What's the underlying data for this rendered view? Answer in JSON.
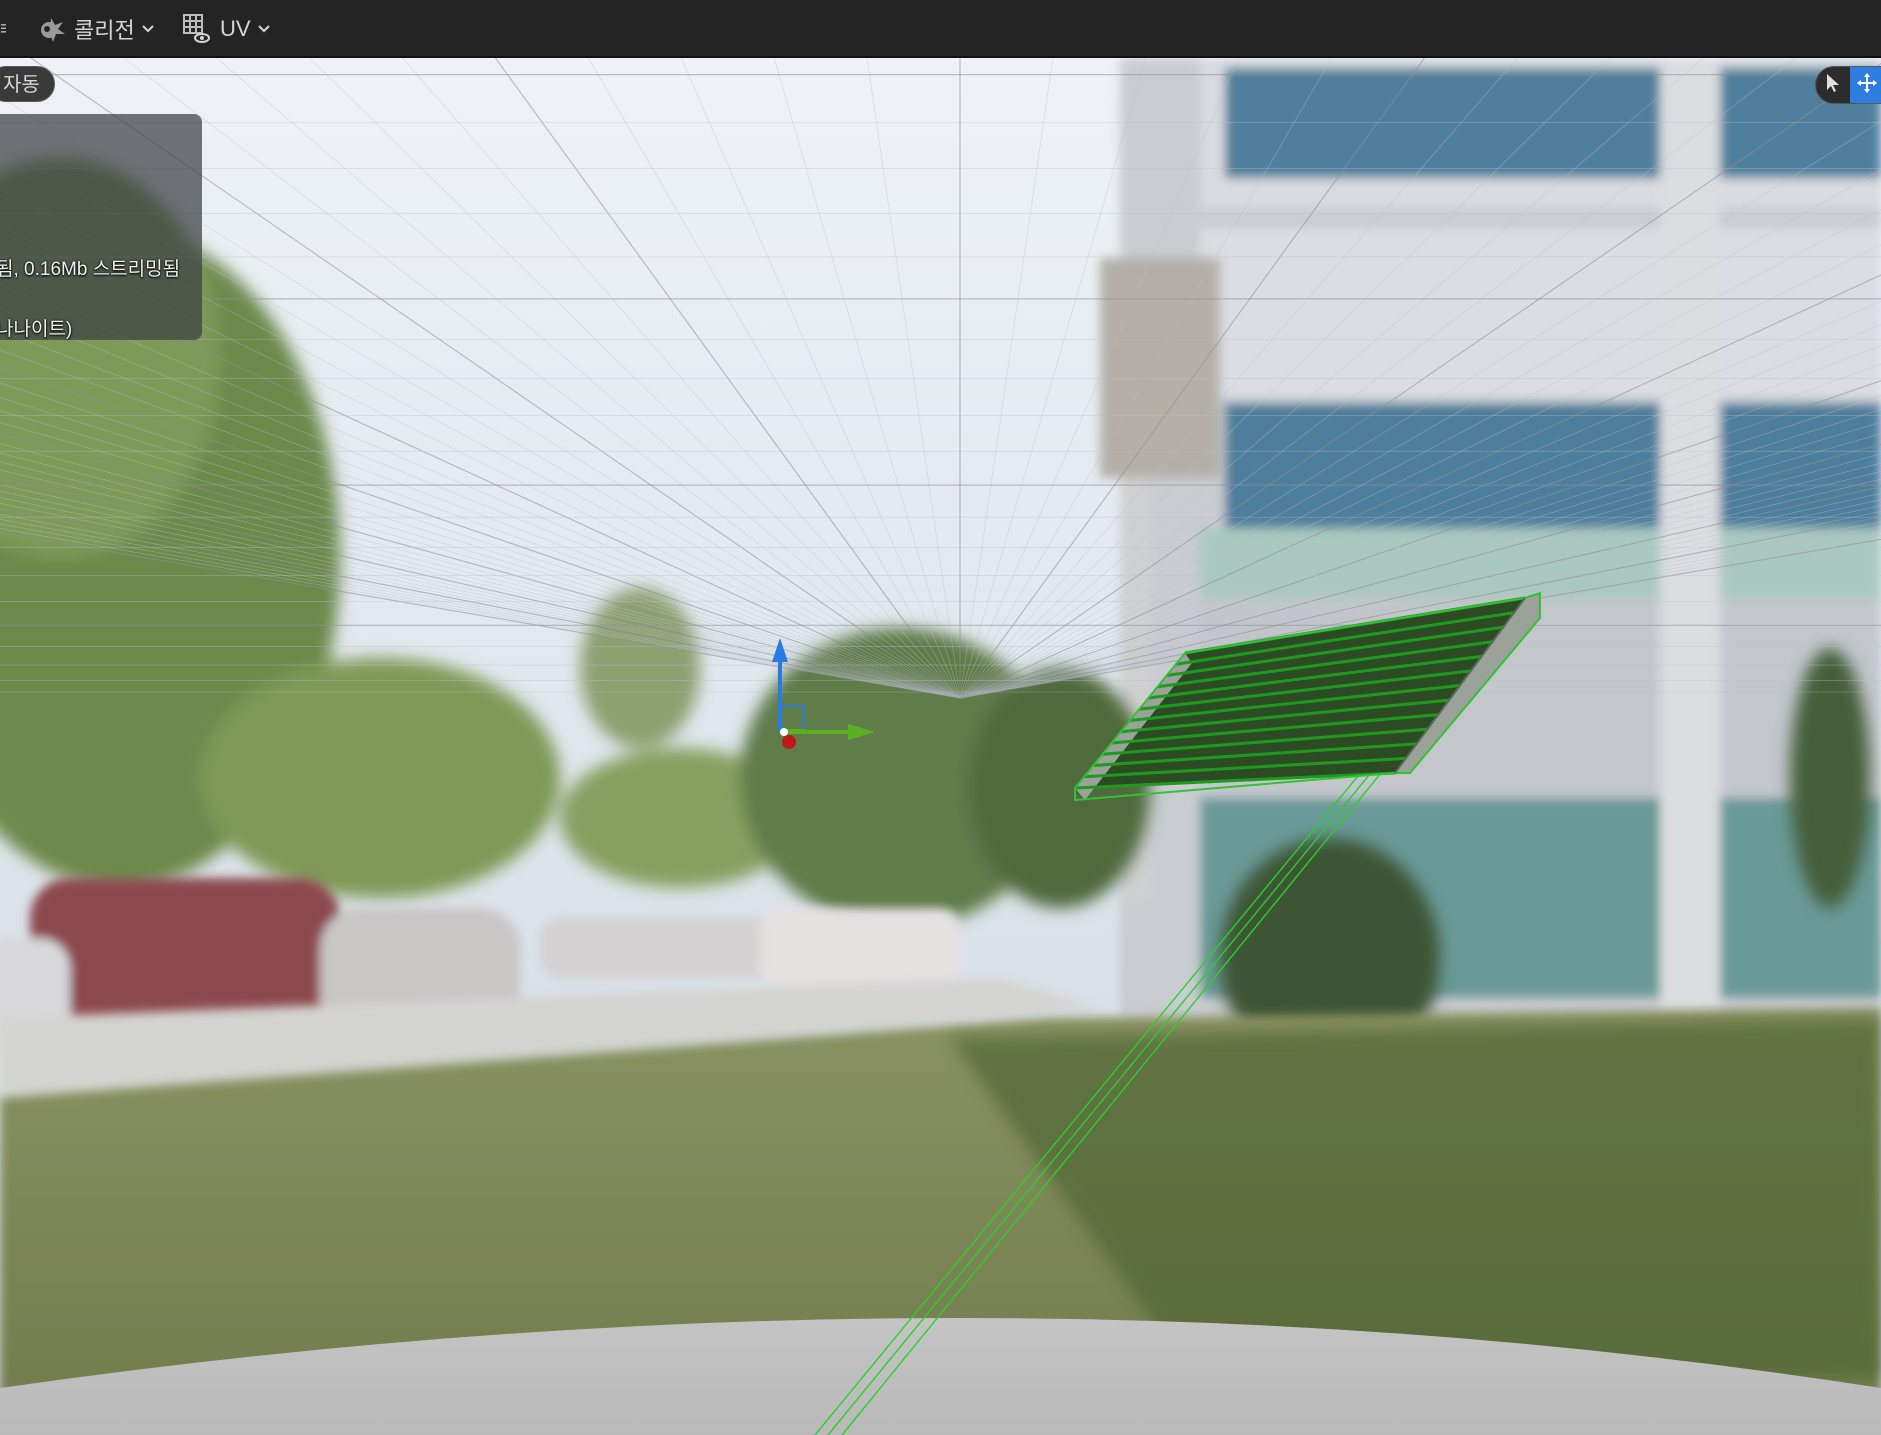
{
  "toolbar": {
    "collision_label": "콜리전",
    "uv_label": "UV",
    "collision_icon": "collision-icon",
    "uv_icon": "uv-grid-icon",
    "dropdown_icon": "chevron-down-icon"
  },
  "viewport": {
    "mode_pill": "자동",
    "stats": {
      "line1": "됨, 0.16Mb 스트리밍됨",
      "line2": "나나이트)"
    },
    "tools": {
      "select_icon": "cursor-icon",
      "move_icon": "move-arrows-icon"
    }
  },
  "colors": {
    "toolbar_bg": "#242424",
    "accent_blue": "#2f7de0",
    "collision_green": "#22c022",
    "gizmo_x": "#c01818",
    "gizmo_y": "#5ab020",
    "gizmo_z": "#2a7be0"
  }
}
